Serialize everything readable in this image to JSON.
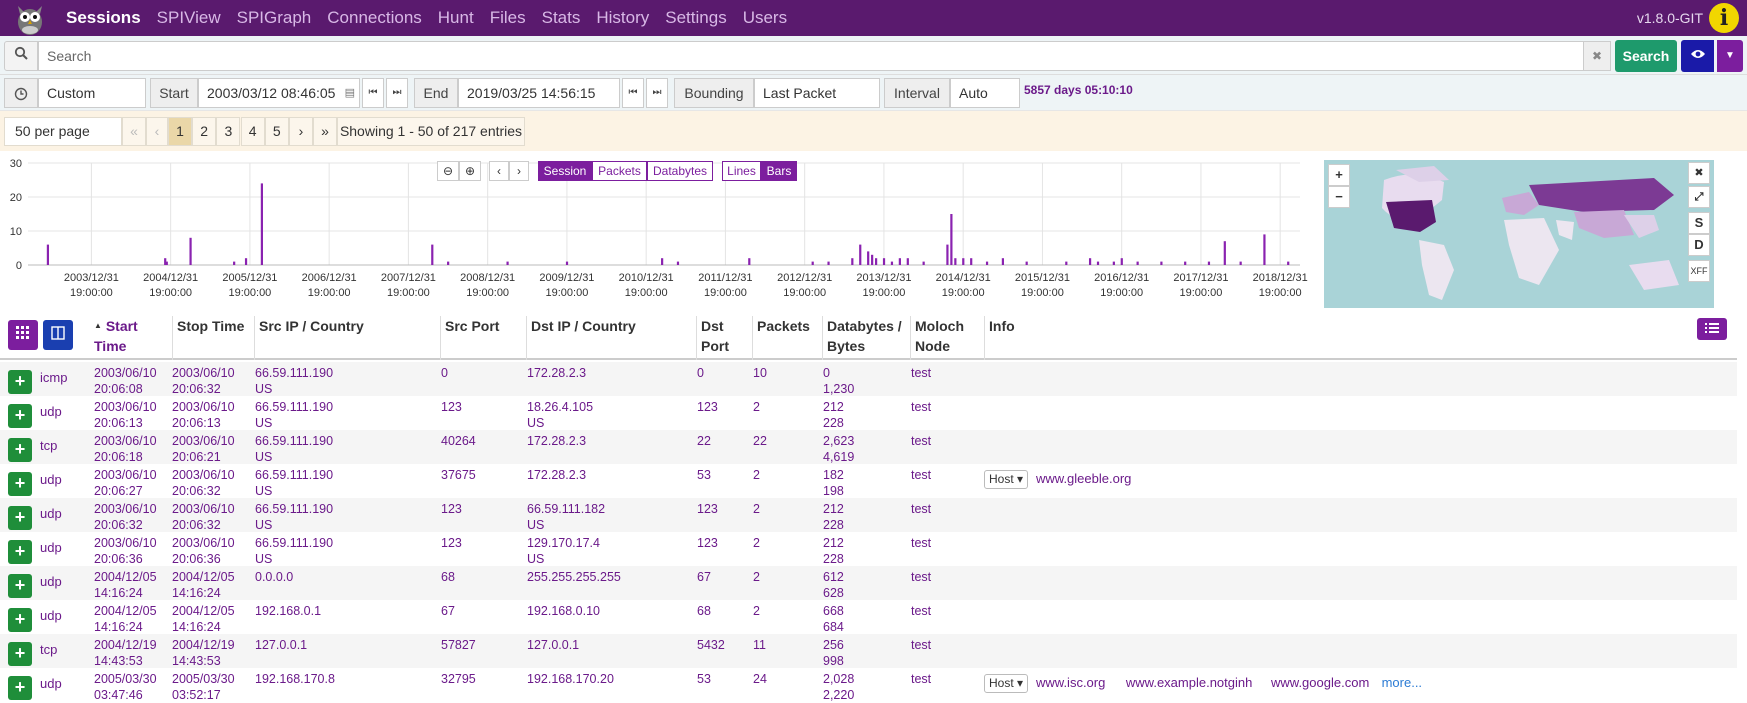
{
  "nav": {
    "items": [
      "Sessions",
      "SPIView",
      "SPIGraph",
      "Connections",
      "Hunt",
      "Files",
      "Stats",
      "History",
      "Settings",
      "Users"
    ],
    "version": "v1.8.0-GIT",
    "info_glyph": "i"
  },
  "search": {
    "placeholder": "Search",
    "clear_glyph": "✖",
    "button_label": "Search"
  },
  "time": {
    "range": "Custom",
    "start_label": "Start",
    "start_value": "2003/03/12 08:46:05",
    "end_label": "End",
    "end_value": "2019/03/25 14:56:15",
    "bounding_label": "Bounding",
    "bounding_value": "Last Packet",
    "interval_label": "Interval",
    "interval_value": "Auto",
    "duration": "5857 days 05:10:10"
  },
  "paging": {
    "per_page": "50 per page",
    "first": "«",
    "prev": "‹",
    "pages": [
      "1",
      "2",
      "3",
      "4",
      "5"
    ],
    "next": "›",
    "last": "»",
    "summary": "Showing 1 - 50 of 217 entries"
  },
  "graph_controls": {
    "session": "Session",
    "packets": "Packets",
    "databytes": "Databytes",
    "lines": "Lines",
    "bars": "Bars"
  },
  "chart_data": {
    "type": "bar",
    "title": "",
    "ylim": [
      0,
      30
    ],
    "yticks": [
      "30",
      "20",
      "10",
      "0"
    ],
    "xticks": [
      "2003/12/31\n19:00:00",
      "2004/12/31\n19:00:00",
      "2005/12/31\n19:00:00",
      "2006/12/31\n19:00:00",
      "2007/12/31\n19:00:00",
      "2008/12/31\n19:00:00",
      "2009/12/31\n19:00:00",
      "2010/12/31\n19:00:00",
      "2011/12/31\n19:00:00",
      "2012/12/31\n19:00:00",
      "2013/12/31\n19:00:00",
      "2014/12/31\n19:00:00",
      "2015/12/31\n19:00:00",
      "2016/12/31\n19:00:00",
      "2017/12/31\n19:00:00",
      "2018/12/31\n19:00:00"
    ],
    "x": [
      2003.45,
      2004.93,
      2004.95,
      2005.25,
      2005.8,
      2005.95,
      2006.15,
      2008.3,
      2008.5,
      2009.25,
      2010.0,
      2011.2,
      2011.4,
      2012.3,
      2013.1,
      2013.3,
      2013.6,
      2013.7,
      2013.8,
      2013.85,
      2013.9,
      2014.0,
      2014.1,
      2014.2,
      2014.3,
      2014.5,
      2014.8,
      2014.85,
      2014.9,
      2015.0,
      2015.1,
      2015.3,
      2015.5,
      2015.8,
      2016.3,
      2016.6,
      2016.7,
      2016.9,
      2017.0,
      2017.2,
      2017.5,
      2017.8,
      2018.1,
      2018.3,
      2018.5,
      2018.8,
      2019.1
    ],
    "values": [
      6,
      2,
      1,
      8,
      1,
      2,
      24,
      6,
      1,
      1,
      1,
      2,
      1,
      2,
      1,
      1,
      2,
      6,
      4,
      3,
      2,
      2,
      1,
      2,
      2,
      1,
      6,
      15,
      2,
      2,
      2,
      1,
      2,
      1,
      1,
      2,
      1,
      1,
      2,
      1,
      1,
      1,
      1,
      7,
      1,
      9,
      1
    ]
  },
  "map_controls": {
    "zoom_in": "+",
    "zoom_out": "−",
    "close": "✖",
    "expand": "⤢",
    "src": "S",
    "dst": "D",
    "xff": "XFF"
  },
  "table": {
    "headers": [
      "Start Time",
      "Stop Time",
      "Src IP / Country",
      "Src Port",
      "Dst IP / Country",
      "Dst Port",
      "Packets",
      "Databytes / Bytes",
      "Moloch Node",
      "Info"
    ],
    "rows": [
      {
        "proto": "icmp",
        "start": "2003/06/10\n20:06:08",
        "stop": "2003/06/10\n20:06:32",
        "src": "66.59.111.190\nUS",
        "sport": "0",
        "dst": "172.28.2.3",
        "dport": "0",
        "packets": "10",
        "bytes": "0\n1,230",
        "node": "test",
        "info": []
      },
      {
        "proto": "udp",
        "start": "2003/06/10\n20:06:13",
        "stop": "2003/06/10\n20:06:13",
        "src": "66.59.111.190\nUS",
        "sport": "123",
        "dst": "18.26.4.105\nUS",
        "dport": "123",
        "packets": "2",
        "bytes": "212\n228",
        "node": "test",
        "info": []
      },
      {
        "proto": "tcp",
        "start": "2003/06/10\n20:06:18",
        "stop": "2003/06/10\n20:06:21",
        "src": "66.59.111.190\nUS",
        "sport": "40264",
        "dst": "172.28.2.3",
        "dport": "22",
        "packets": "22",
        "bytes": "2,623\n4,619",
        "node": "test",
        "info": []
      },
      {
        "proto": "udp",
        "start": "2003/06/10\n20:06:27",
        "stop": "2003/06/10\n20:06:32",
        "src": "66.59.111.190\nUS",
        "sport": "37675",
        "dst": "172.28.2.3",
        "dport": "53",
        "packets": "2",
        "bytes": "182\n198",
        "node": "test",
        "info": [
          "www.gleeble.org"
        ]
      },
      {
        "proto": "udp",
        "start": "2003/06/10\n20:06:32",
        "stop": "2003/06/10\n20:06:32",
        "src": "66.59.111.190\nUS",
        "sport": "123",
        "dst": "66.59.111.182\nUS",
        "dport": "123",
        "packets": "2",
        "bytes": "212\n228",
        "node": "test",
        "info": []
      },
      {
        "proto": "udp",
        "start": "2003/06/10\n20:06:36",
        "stop": "2003/06/10\n20:06:36",
        "src": "66.59.111.190\nUS",
        "sport": "123",
        "dst": "129.170.17.4\nUS",
        "dport": "123",
        "packets": "2",
        "bytes": "212\n228",
        "node": "test",
        "info": []
      },
      {
        "proto": "udp",
        "start": "2004/12/05\n14:16:24",
        "stop": "2004/12/05\n14:16:24",
        "src": "0.0.0.0",
        "sport": "68",
        "dst": "255.255.255.255",
        "dport": "67",
        "packets": "2",
        "bytes": "612\n628",
        "node": "test",
        "info": []
      },
      {
        "proto": "udp",
        "start": "2004/12/05\n14:16:24",
        "stop": "2004/12/05\n14:16:24",
        "src": "192.168.0.1",
        "sport": "67",
        "dst": "192.168.0.10",
        "dport": "68",
        "packets": "2",
        "bytes": "668\n684",
        "node": "test",
        "info": []
      },
      {
        "proto": "tcp",
        "start": "2004/12/19\n14:43:53",
        "stop": "2004/12/19\n14:43:53",
        "src": "127.0.0.1",
        "sport": "57827",
        "dst": "127.0.0.1",
        "dport": "5432",
        "packets": "11",
        "bytes": "256\n998",
        "node": "test",
        "info": []
      },
      {
        "proto": "udp",
        "start": "2005/03/30\n03:47:46",
        "stop": "2005/03/30\n03:52:17",
        "src": "192.168.170.8",
        "sport": "32795",
        "dst": "192.168.170.20",
        "dport": "53",
        "packets": "24",
        "bytes": "2,028\n2,220",
        "node": "test",
        "info": [
          "www.isc.org",
          "www.example.notginh",
          "www.google.com"
        ]
      }
    ],
    "host_label": "Host",
    "more_label": "more..."
  },
  "colors": {
    "nav": "#5a1a6e",
    "accent": "#7c1e9e",
    "search": "#1e9a6c",
    "plus": "#1f8e3a"
  }
}
